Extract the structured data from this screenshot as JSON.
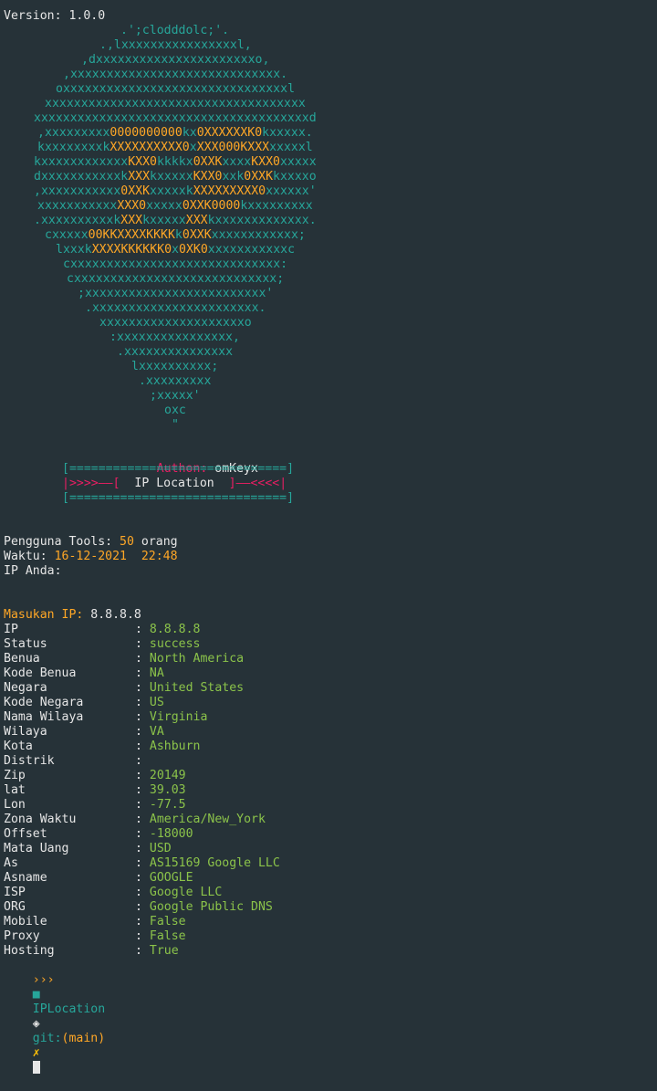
{
  "version_line": "Version: 1.0.0",
  "ascii_art": [
    ".';clodddolc;'.",
    ".,lxxxxxxxxxxxxxxxxl,",
    ",dxxxxxxxxxxxxxxxxxxxxxxo,",
    ",xxxxxxxxxxxxxxxxxxxxxxxxxxxxx.",
    "oxxxxxxxxxxxxxxxxxxxxxxxxxxxxxxxl",
    "xxxxxxxxxxxxxxxxxxxxxxxxxxxxxxxxxxxx",
    "xxxxxxxxxxxxxxxxxxxxxxxxxxxxxxxxxxxxxxd",
    ",xxxxxxxxx0000000000kx0XXXXXXK0kxxxxx.",
    "kxxxxxxxxkXXXXXXXXXX0xXXX000KXXXxxxxxl",
    "kxxxxxxxxxxxxKXX0kkkkx0XXKxxxxKXX0xxxxx",
    "dxxxxxxxxxxxkXXXkxxxxxKXX0xxk0XXKkxxxxo",
    ",xxxxxxxxxxx0XXKxxxxxkXXXXXXXXX0xxxxxx'",
    "xxxxxxxxxxxXXX0xxxxx0XXK0000kxxxxxxxxx",
    ".xxxxxxxxxxkXXXkxxxxxXXXkxxxxxxxxxxxxx.",
    "cxxxxx00KKXXXXKKKKk0XXKxxxxxxxxxxxx;",
    "lxxxkXXXXKKKKKK0x0XK0xxxxxxxxxxxc",
    "cxxxxxxxxxxxxxxxxxxxxxxxxxxxxx:",
    "cxxxxxxxxxxxxxxxxxxxxxxxxxxxx;",
    ";xxxxxxxxxxxxxxxxxxxxxxxxx'",
    ".xxxxxxxxxxxxxxxxxxxxxxx.",
    "xxxxxxxxxxxxxxxxxxxxo",
    ":xxxxxxxxxxxxxxxx,",
    ".xxxxxxxxxxxxxxx",
    "lxxxxxxxxxx;",
    ".xxxxxxxxx",
    ";xxxxx'",
    "oxc",
    "\""
  ],
  "author": {
    "label": "Authon:",
    "name": "omKeyx"
  },
  "banner": {
    "border": "[==============================]",
    "left_arrows": "|>>>>——[",
    "title": "  IP Location  ",
    "right_arrows": "]——<<<<|"
  },
  "stats": {
    "users_label": "Pengguna Tools:",
    "users_count": "50",
    "users_unit": "orang",
    "time_label": "Waktu:",
    "time_value": "16-12-2021  22:48",
    "ip_label": "IP Anda:"
  },
  "prompt": {
    "label": "Masukan IP:",
    "value": "8.8.8.8"
  },
  "results": [
    {
      "key": "IP",
      "value": "8.8.8.8"
    },
    {
      "key": "Status",
      "value": "success"
    },
    {
      "key": "Benua",
      "value": "North America"
    },
    {
      "key": "Kode Benua",
      "value": "NA"
    },
    {
      "key": "Negara",
      "value": "United States"
    },
    {
      "key": "Kode Negara",
      "value": "US"
    },
    {
      "key": "Nama Wilaya",
      "value": "Virginia"
    },
    {
      "key": "Wilaya",
      "value": "VA"
    },
    {
      "key": "Kota",
      "value": "Ashburn"
    },
    {
      "key": "Distrik",
      "value": ""
    },
    {
      "key": "Zip",
      "value": "20149"
    },
    {
      "key": "lat",
      "value": "39.03"
    },
    {
      "key": "Lon",
      "value": "-77.5"
    },
    {
      "key": "Zona Waktu",
      "value": "America/New_York"
    },
    {
      "key": "Offset",
      "value": "-18000"
    },
    {
      "key": "Mata Uang",
      "value": "USD"
    },
    {
      "key": "As",
      "value": "AS15169 Google LLC"
    },
    {
      "key": "Asname",
      "value": "GOOGLE"
    },
    {
      "key": "ISP",
      "value": "Google LLC"
    },
    {
      "key": "ORG",
      "value": "Google Public DNS"
    },
    {
      "key": "Mobile",
      "value": "False"
    },
    {
      "key": "Proxy",
      "value": "False"
    },
    {
      "key": "Hosting",
      "value": "True"
    }
  ],
  "shell": {
    "arrows": "›››",
    "dir": "IPLocation",
    "git_label": "git:",
    "branch": "(main)",
    "dirty_mark": "✗"
  },
  "colors": {
    "background": "#263238",
    "teal": "#26a69a",
    "orange": "#ffa726",
    "green": "#8bc34a",
    "pink": "#e91e63"
  },
  "icons": {
    "folder": "folder-icon",
    "git": "git-icon"
  }
}
